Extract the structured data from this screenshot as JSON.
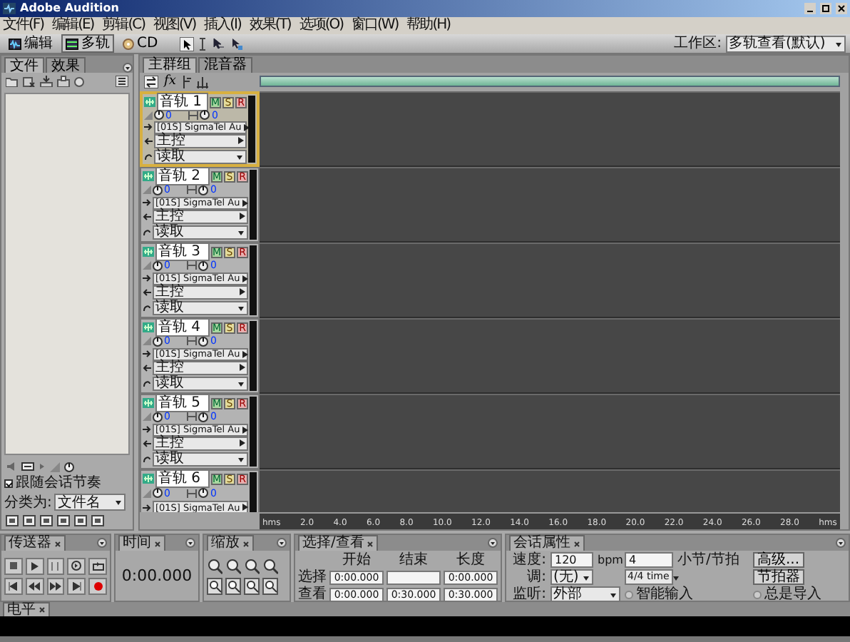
{
  "window": {
    "title": "Adobe Audition"
  },
  "menu": [
    "文件(F)",
    "编辑(E)",
    "剪辑(C)",
    "视图(V)",
    "插入(I)",
    "效果(T)",
    "选项(O)",
    "窗口(W)",
    "帮助(H)"
  ],
  "toolbar": {
    "modes": [
      {
        "label": "编辑",
        "kind": "edit",
        "selected": false
      },
      {
        "label": "多轨",
        "kind": "multitrack",
        "selected": true
      },
      {
        "label": "CD",
        "kind": "cd",
        "selected": false
      }
    ],
    "workspace_label": "工作区:",
    "workspace": "多轨查看(默认)"
  },
  "files_panel": {
    "tabs": [
      {
        "label": "文件",
        "selected": true
      },
      {
        "label": "效果",
        "selected": false
      }
    ],
    "follow_tempo": {
      "label": "跟随会话节奏",
      "checked": true
    },
    "sort_label": "分类为:",
    "sort_value": "文件名"
  },
  "main_panel": {
    "tabs": [
      {
        "label": "主群组",
        "selected": true
      },
      {
        "label": "混音器",
        "selected": false
      }
    ],
    "fx_label": "fx",
    "tracks": [
      {
        "name": "音轨 1",
        "selected": true,
        "volume": "0",
        "pan": "0",
        "input": "[01S] SigmaTel Au",
        "output": "主控",
        "automation": "读取",
        "buttons": [
          {
            "label": "M",
            "kind": "mute"
          },
          {
            "label": "S",
            "kind": "solo"
          },
          {
            "label": "R",
            "kind": "record"
          }
        ]
      },
      {
        "name": "音轨 2",
        "selected": false,
        "volume": "0",
        "pan": "0",
        "input": "[01S] SigmaTel Au",
        "output": "主控",
        "automation": "读取",
        "buttons": [
          {
            "label": "M",
            "kind": "mute"
          },
          {
            "label": "S",
            "kind": "solo"
          },
          {
            "label": "R",
            "kind": "record"
          }
        ]
      },
      {
        "name": "音轨 3",
        "selected": false,
        "volume": "0",
        "pan": "0",
        "input": "[01S] SigmaTel Au",
        "output": "主控",
        "automation": "读取",
        "buttons": [
          {
            "label": "M",
            "kind": "mute"
          },
          {
            "label": "S",
            "kind": "solo"
          },
          {
            "label": "R",
            "kind": "record"
          }
        ]
      },
      {
        "name": "音轨 4",
        "selected": false,
        "volume": "0",
        "pan": "0",
        "input": "[01S] SigmaTel Au",
        "output": "主控",
        "automation": "读取",
        "buttons": [
          {
            "label": "M",
            "kind": "mute"
          },
          {
            "label": "S",
            "kind": "solo"
          },
          {
            "label": "R",
            "kind": "record"
          }
        ]
      },
      {
        "name": "音轨 5",
        "selected": false,
        "volume": "0",
        "pan": "0",
        "input": "[01S] SigmaTel Au",
        "output": "主控",
        "automation": "读取",
        "buttons": [
          {
            "label": "M",
            "kind": "mute"
          },
          {
            "label": "S",
            "kind": "solo"
          },
          {
            "label": "R",
            "kind": "record"
          }
        ]
      },
      {
        "name": "音轨 6",
        "selected": false,
        "volume": "0",
        "pan": "0",
        "input": "[01S] SigmaTel Au",
        "buttons": [
          {
            "label": "M",
            "kind": "mute"
          },
          {
            "label": "S",
            "kind": "solo"
          },
          {
            "label": "R",
            "kind": "record"
          }
        ]
      }
    ],
    "ruler": [
      "hms",
      "2.0",
      "4.0",
      "6.0",
      "8.0",
      "10.0",
      "12.0",
      "14.0",
      "16.0",
      "18.0",
      "20.0",
      "22.0",
      "24.0",
      "26.0",
      "28.0",
      "hms"
    ]
  },
  "transport": {
    "title": "传送器"
  },
  "time": {
    "title": "时间",
    "value": "0:00.000"
  },
  "zoom": {
    "title": "缩放"
  },
  "selection_view": {
    "title": "选择/查看",
    "columns": [
      "开始",
      "结束",
      "长度"
    ],
    "rows": [
      {
        "label": "选择",
        "start": "0:00.000",
        "length": "0:00.000"
      },
      {
        "label": "查看",
        "start": "0:00.000",
        "end": "0:30.000",
        "length": "0:30.000"
      }
    ]
  },
  "session": {
    "title": "会话属性",
    "tempo_label": "速度:",
    "tempo": "120",
    "tempo_unit": "bpm",
    "beats": "4",
    "beats_label": "小节/节拍",
    "advanced": "高级...",
    "key_label": "调:",
    "key": "(无)",
    "time_signature": "4/4 time",
    "metronome": "节拍器",
    "monitor_label": "监听:",
    "monitor": "外部",
    "smart_input": {
      "label": "智能输入",
      "checked": false
    },
    "always_import": {
      "label": "总是导入",
      "checked": false
    }
  },
  "level_panel": {
    "title": "电平"
  }
}
